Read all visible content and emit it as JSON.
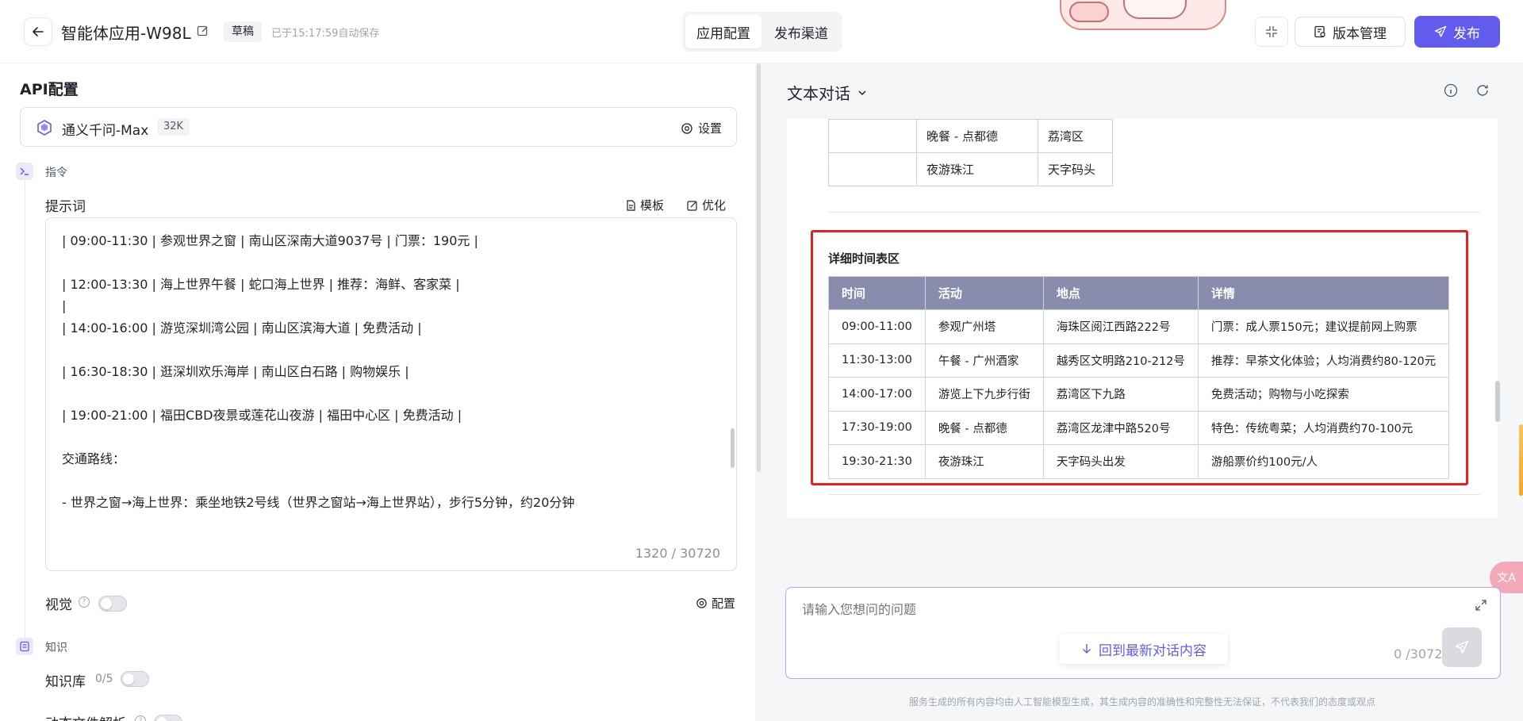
{
  "header": {
    "app_title": "智能体应用-W98L",
    "draft_badge": "草稿",
    "autosave": "已于15:17:59自动保存",
    "tabs": [
      {
        "label": "应用配置",
        "active": true
      },
      {
        "label": "发布渠道",
        "active": false
      }
    ],
    "version_label": "版本管理",
    "publish_label": "发布",
    "accent_color": "#615ced"
  },
  "left": {
    "api_title": "API配置",
    "model": {
      "name": "通义千问-Max",
      "context": "32K",
      "setting_label": "设置"
    },
    "instruction_section": "指令",
    "prompt": {
      "label": "提示词",
      "template_label": "模板",
      "optimize_label": "优化",
      "lines": [
        "| 09:00-11:30 | 参观世界之窗 | 南山区深南大道9037号 | 门票：190元 |",
        "| 12:00-13:30 | 海上世界午餐 | 蛇口海上世界 | 推荐：海鲜、客家菜 |",
        "|",
        "| 14:00-16:00 | 游览深圳湾公园 | 南山区滨海大道 | 免费活动 |",
        "| 16:30-18:30 | 逛深圳欢乐海岸 | 南山区白石路 | 购物娱乐 |",
        "| 19:00-21:00 | 福田CBD夜景或莲花山夜游 | 福田中心区 | 免费活动 |",
        "交通路线：",
        "- 世界之窗→海上世界：乘坐地铁2号线（世界之窗站→海上世界站），步行5分钟，约20分钟"
      ],
      "count": "1320 / 30720"
    },
    "vision_label": "视觉",
    "vision_config_label": "配置",
    "knowledge_section": "知识",
    "kb_label": "知识库",
    "kb_count": "0/5",
    "dynamic_file_label": "动态文件解析"
  },
  "right": {
    "chat_title": "文本对话",
    "top_rows": [
      [
        "",
        "晚餐 - 点都德",
        "荔湾区"
      ],
      [
        "",
        "夜游珠江",
        "天字码头"
      ]
    ],
    "schedule": {
      "title": "详细时间表区",
      "columns": [
        "时间",
        "活动",
        "地点",
        "详情"
      ],
      "rows": [
        [
          "09:00-11:00",
          "参观广州塔",
          "海珠区阅江西路222号",
          "门票：成人票150元；建议提前网上购票"
        ],
        [
          "11:30-13:00",
          "午餐 - 广州酒家",
          "越秀区文明路210-212号",
          "推荐：早茶文化体验；人均消费约80-120元"
        ],
        [
          "14:00-17:00",
          "游览上下九步行街",
          "荔湾区下九路",
          "免费活动；购物与小吃探索"
        ],
        [
          "17:30-19:00",
          "晚餐 - 点都德",
          "荔湾区龙津中路520号",
          "特色：传统粤菜；人均消费约70-100元"
        ],
        [
          "19:30-21:30",
          "夜游珠江",
          "天字码头出发",
          "游船票价约100元/人"
        ]
      ]
    },
    "input": {
      "placeholder": "请输入您想问的问题",
      "latest_label": "回到最新对话内容",
      "count": "0 /30720"
    },
    "disclaimer": "服务生成的所有内容均由人工智能模型生成，其生成内容的准确性和完整性无法保证，不代表我们的态度或观点"
  }
}
